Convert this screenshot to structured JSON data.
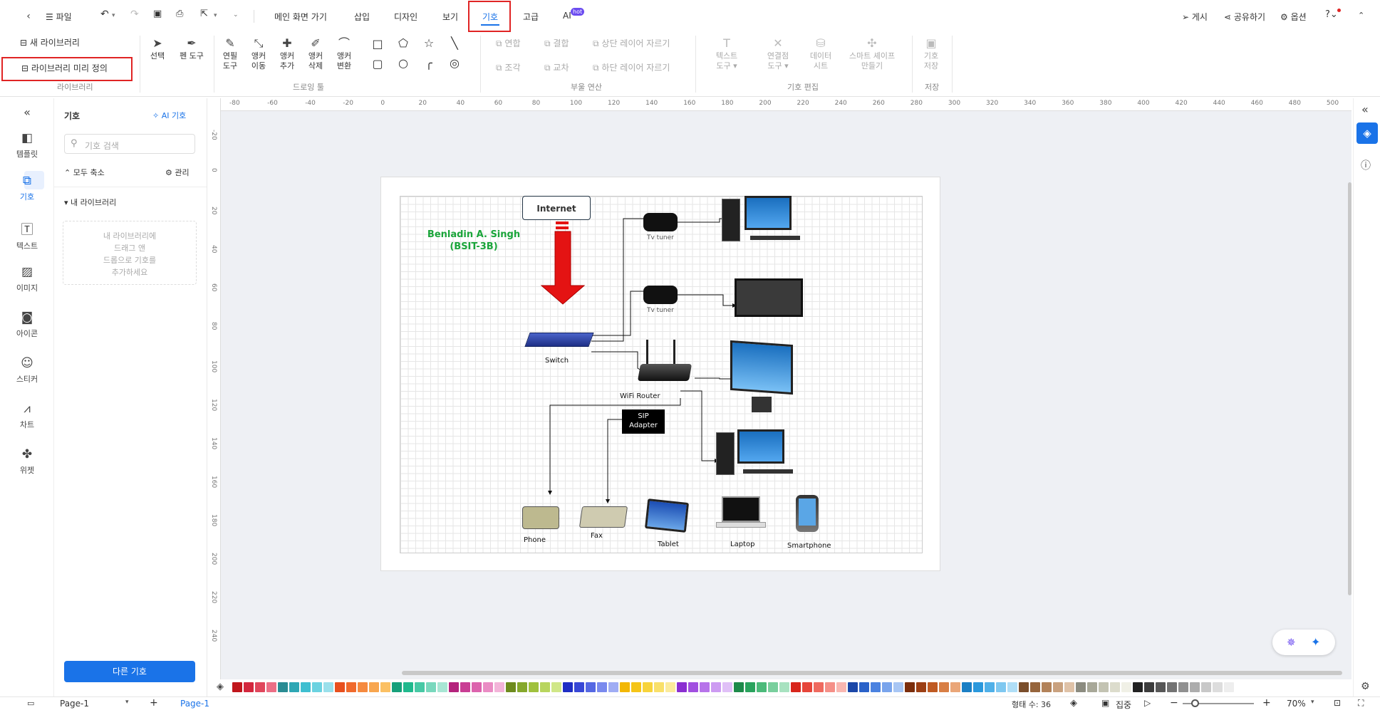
{
  "menubar": {
    "file": "파일",
    "tabs": [
      "메인 화면 가기",
      "삽입",
      "디자인",
      "보기",
      "기호",
      "고급",
      "AI"
    ],
    "ai_badge": "hot",
    "publish": "게시",
    "share": "공유하기",
    "options": "옵션"
  },
  "ribbon": {
    "new_library": "새 라이브러리",
    "define_library": "라이브러리 미리 정의",
    "group_library": "라이브러리",
    "select": "선택",
    "pen_tool": "펜 도구",
    "pencil": [
      "연필",
      "도구"
    ],
    "move_anchor": [
      "앵커",
      "이동"
    ],
    "add_anchor": [
      "앵커",
      "추가"
    ],
    "del_anchor": [
      "앵커",
      "삭제"
    ],
    "convert_anchor": [
      "앵커",
      "변환"
    ],
    "group_drawing": "드로잉 툴",
    "union": "연합",
    "combine": "결합",
    "fragment": "조각",
    "intersect": "교차",
    "trim_upper": "상단 레이어 자르기",
    "trim_lower": "하단 레이어 자르기",
    "group_boolean": "부울 연산",
    "text_tool": [
      "텍스트",
      "도구"
    ],
    "connect_tool": [
      "연결점",
      "도구"
    ],
    "datasheet": [
      "데이터",
      "시트"
    ],
    "smart_shape": [
      "스마트 셰이프",
      "만들기"
    ],
    "group_symbol_edit": "기호 편집",
    "save_symbol": [
      "기호",
      "저장"
    ],
    "group_save": "저장"
  },
  "leftrail": [
    "템플릿",
    "기호",
    "텍스트",
    "이미지",
    "아이콘",
    "스티커",
    "차트",
    "위젯"
  ],
  "panel": {
    "title": "기호",
    "ai_symbol": "AI 기호",
    "search_placeholder": "기호 검색",
    "collapse_all": "모두 축소",
    "manage": "관리",
    "my_library": "내 라이브러리",
    "drop_hint": [
      "내 라이브러리에",
      "드래그 앤",
      "드롭으로 기호를",
      "추가하세요"
    ],
    "other_symbols": "다른 기호"
  },
  "ruler": {
    "top": [
      "-80",
      "-60",
      "-40",
      "-20",
      "0",
      "20",
      "40",
      "60",
      "80",
      "100",
      "120",
      "140",
      "160",
      "180",
      "200",
      "220",
      "240",
      "260",
      "280",
      "300",
      "320",
      "340",
      "360",
      "380",
      "400",
      "420",
      "440",
      "460",
      "480",
      "500"
    ],
    "left": [
      "-20",
      "0",
      "20",
      "40",
      "60",
      "80",
      "100",
      "120",
      "140",
      "160",
      "180",
      "200",
      "220",
      "240"
    ]
  },
  "diagram": {
    "internet": "Internet",
    "title": [
      "Benladin A. Singh",
      "(BSIT-3B)"
    ],
    "tv_tuner": "Tv tuner",
    "switch": "Switch",
    "router": "WiFi Router",
    "sip": [
      "SIP",
      "Adapter"
    ],
    "devices": [
      "Phone",
      "Fax",
      "Tablet",
      "Laptop",
      "Smartphone"
    ]
  },
  "status": {
    "page_tab": "Page-1",
    "page_active": "Page-1",
    "shape_count": "형태 수: 36",
    "focus": "집중",
    "zoom": "70%"
  },
  "colors": {
    "accent": "#1a73e8",
    "highlight": "#e02424",
    "title_green": "#1aa53a"
  },
  "palette": [
    "#c0161c",
    "#d3273d",
    "#e0475c",
    "#ec6f86",
    "#2a8c93",
    "#2ea7b4",
    "#3fbfd0",
    "#6bd2e0",
    "#9ae0eb",
    "#e8501e",
    "#f06a2c",
    "#f58a3f",
    "#f8a64f",
    "#fbc063",
    "#17a07a",
    "#20b98d",
    "#48c9a5",
    "#79d8bd",
    "#a8e6d4",
    "#b4237c",
    "#c93e94",
    "#dc63ad",
    "#ea8cc4",
    "#f3b4d9",
    "#6e8b1e",
    "#86a82c",
    "#a0c13d",
    "#b8d55e",
    "#d0e788",
    "#1f2ec4",
    "#3848d6",
    "#5568e3",
    "#7a8aee",
    "#a0adf4",
    "#f2b705",
    "#f5c518",
    "#f7d33b",
    "#f9e06a",
    "#fbeb9c",
    "#8b2fd1",
    "#a14fe0",
    "#b774ea",
    "#cd9bf2",
    "#e0c0f7",
    "#1e8a4a",
    "#2aa35d",
    "#4cba7a",
    "#79cf9d",
    "#a8e2c0",
    "#d8261c",
    "#e6453a",
    "#ef6a5f",
    "#f59088",
    "#f9b7b1",
    "#1b47a8",
    "#2a62c9",
    "#4b82e0",
    "#79a4ec",
    "#a8c6f4",
    "#7b2e0c",
    "#9c3f14",
    "#bf5a22",
    "#d87f45",
    "#eaa678",
    "#1b7fc4",
    "#2a98dc",
    "#50b0e8",
    "#7fc8f0",
    "#b0def6",
    "#7a4e2b",
    "#96653c",
    "#b28259",
    "#c9a17e",
    "#dfc2a7",
    "#8c8c80",
    "#a8a898",
    "#c3c3b2",
    "#dcdccc",
    "#f0f0e6",
    "#222222",
    "#3c3c3c",
    "#575757",
    "#737373",
    "#909090",
    "#adadad",
    "#c8c8c8",
    "#dddddd",
    "#eeeeee"
  ]
}
